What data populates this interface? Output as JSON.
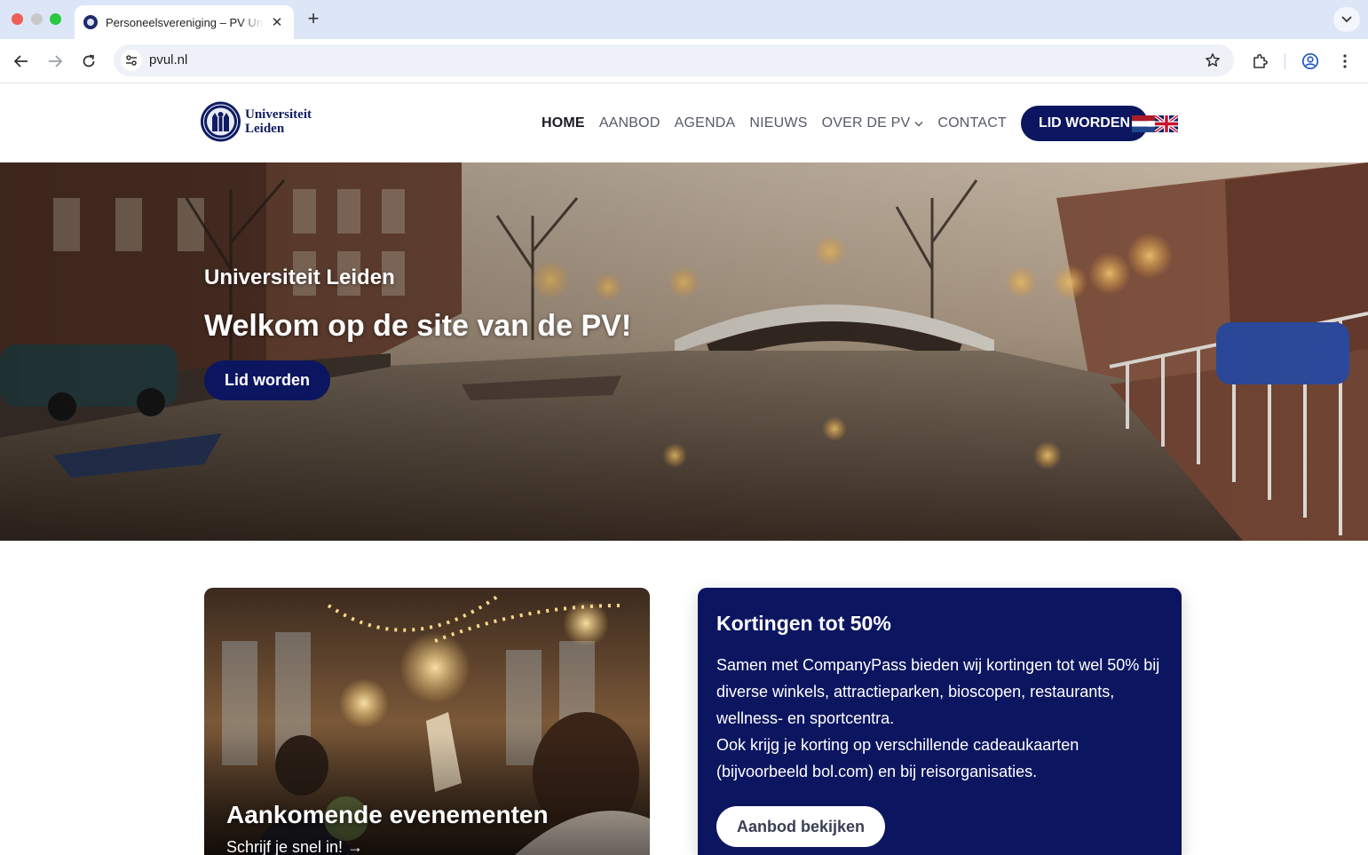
{
  "browser": {
    "tab_title": "Personeelsvereniging – PV Universiteit Leiden",
    "url": "pvul.nl",
    "icons": {
      "back": "arrow-left-icon",
      "forward": "arrow-right-icon",
      "reload": "reload-icon",
      "site_info": "tune-icon",
      "bookmark": "star-icon",
      "extensions": "puzzle-icon",
      "profile": "account-icon",
      "menu": "kebab-icon",
      "tab_close": "close-icon",
      "new_tab": "plus-icon",
      "tab_search": "chevron-down-icon"
    }
  },
  "header": {
    "logo_line1": "Universiteit",
    "logo_line2": "Leiden",
    "nav": [
      {
        "label": "HOME",
        "active": true
      },
      {
        "label": "AANBOD"
      },
      {
        "label": "AGENDA"
      },
      {
        "label": "NIEUWS"
      },
      {
        "label": "OVER DE PV",
        "has_dropdown": true
      },
      {
        "label": "CONTACT"
      }
    ],
    "cta": "LID WORDEN"
  },
  "hero": {
    "eyebrow": "Universiteit Leiden",
    "title": "Welkom op de site van de PV!",
    "button": "Lid worden"
  },
  "events_card": {
    "title": "Aankomende evenementen",
    "subtitle": "Schrijf je snel in! →"
  },
  "discount_card": {
    "title": "Kortingen tot 50%",
    "paragraph1": "Samen met CompanyPass bieden wij kortingen tot wel 50% bij diverse winkels, attractieparken, bioscopen, restaurants, wellness- en sportcentra.",
    "paragraph2": "Ook krijg je korting op verschillende cadeaukaarten (bijvoorbeeld bol.com) en bij reisorganisaties.",
    "button": "Aanbod bekijken"
  },
  "colors": {
    "brand_navy": "#0c1660",
    "tab_strip": "#dde6f7",
    "omnibox": "#eef1f7"
  }
}
